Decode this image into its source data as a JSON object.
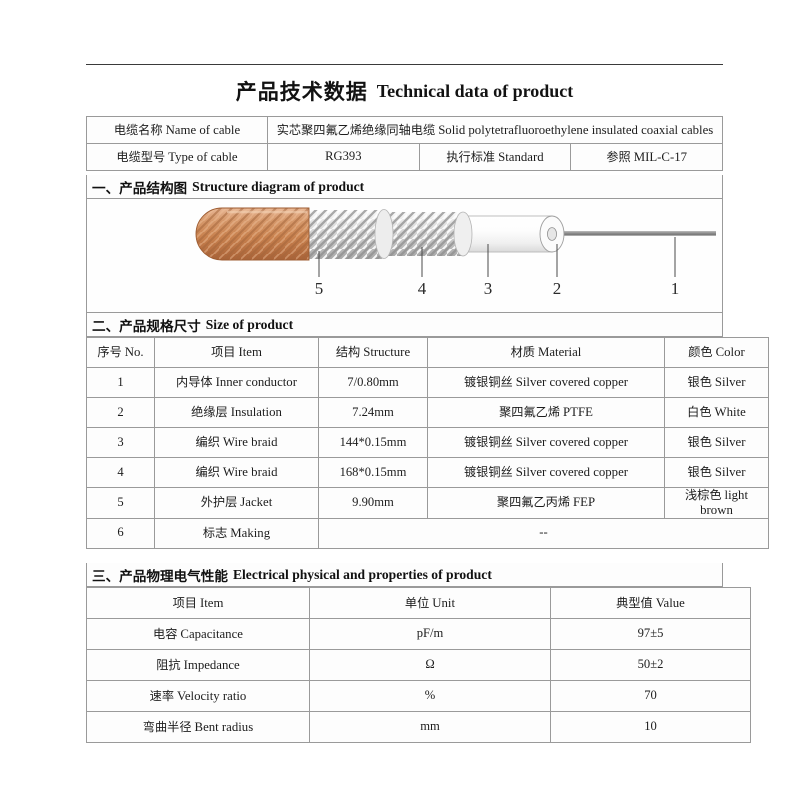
{
  "title": {
    "cn": "产品技术数据",
    "en": "Technical data of product"
  },
  "info": {
    "name_label_cn": "电缆名称",
    "name_label_en": "Name of cable",
    "name_value_cn": "实芯聚四氟乙烯绝缘同轴电缆",
    "name_value_en": "Solid polytetrafluoroethylene insulated coaxial cables",
    "type_label_cn": "电缆型号",
    "type_label_en": "Type of cable",
    "type_value": "RG393",
    "standard_label_cn": "执行标准",
    "standard_label_en": "Standard",
    "standard_value_cn": "参照",
    "standard_value_en": "MIL-C-17"
  },
  "sections": {
    "structure": {
      "cn": "一、产品结构图",
      "en": "Structure diagram of product"
    },
    "size": {
      "cn": "二、产品规格尺寸",
      "en": "Size of product"
    },
    "electrical": {
      "cn": "三、产品物理电气性能",
      "en": "Electrical physical and properties of product"
    }
  },
  "diagram": {
    "callouts": [
      "5",
      "4",
      "3",
      "2",
      "1"
    ],
    "colors": {
      "jacket": "#cf8a5d",
      "braid": "#d8d8d8",
      "insulation": "#fcfcfc",
      "conductor": "#8c8c8c"
    }
  },
  "size_table": {
    "headers": [
      {
        "cn": "序号",
        "en": "No."
      },
      {
        "cn": "项目",
        "en": "Item"
      },
      {
        "cn": "结构",
        "en": "Structure"
      },
      {
        "cn": "材质",
        "en": "Material"
      },
      {
        "cn": "颜色",
        "en": "Color"
      }
    ],
    "rows": [
      {
        "no": "1",
        "item_cn": "内导体",
        "item_en": "Inner conductor",
        "structure": "7/0.80mm",
        "material_cn": "镀银铜丝",
        "material_en": "Silver covered copper",
        "color_cn": "银色",
        "color_en": "Silver"
      },
      {
        "no": "2",
        "item_cn": "绝缘层",
        "item_en": "Insulation",
        "structure": "7.24mm",
        "material_cn": "聚四氟乙烯",
        "material_en": "PTFE",
        "color_cn": "白色",
        "color_en": "White"
      },
      {
        "no": "3",
        "item_cn": "编织",
        "item_en": "Wire braid",
        "structure": "144*0.15mm",
        "material_cn": "镀银铜丝",
        "material_en": "Silver covered copper",
        "color_cn": "银色",
        "color_en": "Silver"
      },
      {
        "no": "4",
        "item_cn": "编织",
        "item_en": "Wire braid",
        "structure": "168*0.15mm",
        "material_cn": "镀银铜丝",
        "material_en": "Silver covered copper",
        "color_cn": "银色",
        "color_en": "Silver"
      },
      {
        "no": "5",
        "item_cn": "外护层",
        "item_en": "Jacket",
        "structure": "9.90mm",
        "material_cn": "聚四氟乙丙烯",
        "material_en": "FEP",
        "color_cn": "浅棕色",
        "color_en": "light brown"
      },
      {
        "no": "6",
        "item_cn": "标志",
        "item_en": "Making",
        "structure": "",
        "material_cn": "",
        "material_en": "--",
        "color_cn": "",
        "color_en": ""
      }
    ]
  },
  "elec_table": {
    "headers": [
      {
        "cn": "项目",
        "en": "Item"
      },
      {
        "cn": "单位",
        "en": "Unit"
      },
      {
        "cn": "典型值",
        "en": "Value"
      }
    ],
    "rows": [
      {
        "item_cn": "电容",
        "item_en": "Capacitance",
        "unit": "pF/m",
        "value": "97±5"
      },
      {
        "item_cn": "阻抗",
        "item_en": "Impedance",
        "unit": "Ω",
        "value": "50±2"
      },
      {
        "item_cn": "速率",
        "item_en": "Velocity ratio",
        "unit": "%",
        "value": "70"
      },
      {
        "item_cn": "弯曲半径",
        "item_en": "Bent radius",
        "unit": "mm",
        "value": "10"
      }
    ]
  }
}
